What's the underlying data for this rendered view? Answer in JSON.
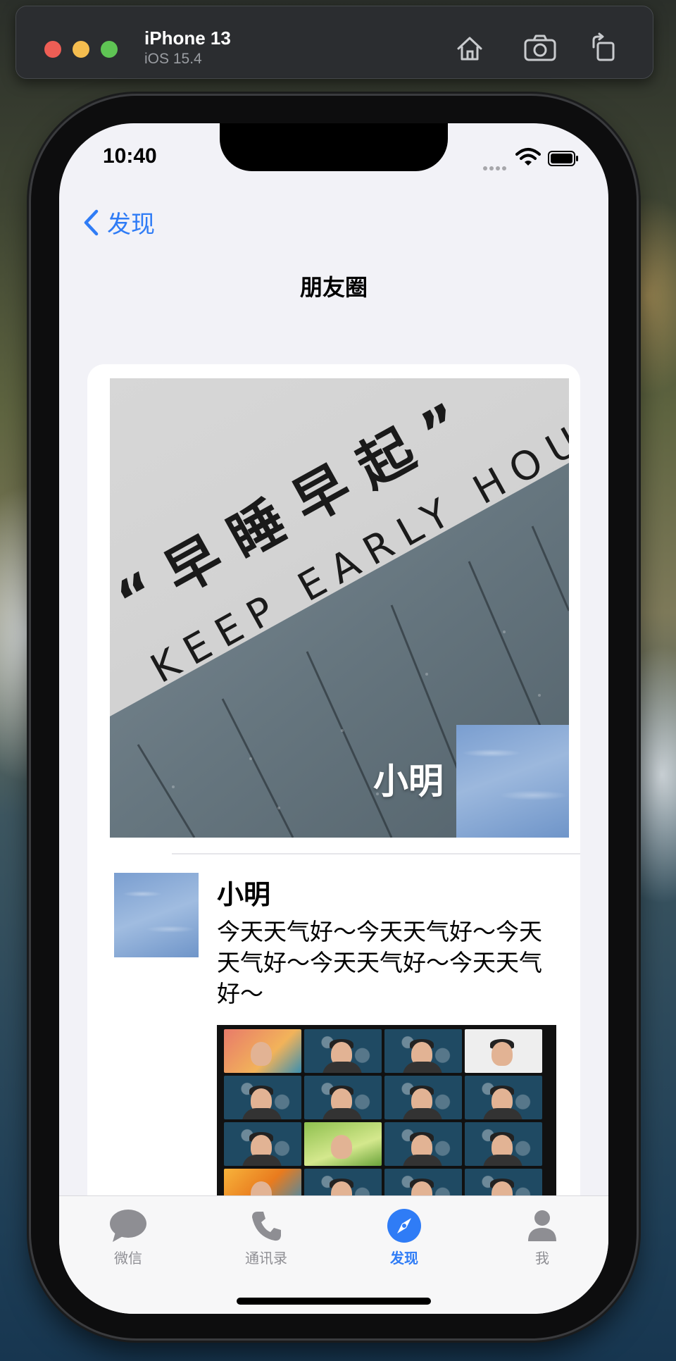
{
  "simulator": {
    "device_name": "iPhone 13",
    "os_version": "iOS 15.4",
    "toolbar_icons": [
      "home-icon",
      "screenshot-icon",
      "rotate-icon"
    ]
  },
  "status_bar": {
    "time": "10:40"
  },
  "nav": {
    "back_label": "发现",
    "title": "朋友圈"
  },
  "cover": {
    "name": "小明",
    "image_text_cn": "“早睡早起”",
    "image_text_en": "KEEP EARLY HOURS"
  },
  "post": {
    "author": "小明",
    "text": "今天天气好～今天天气好～今天天气好～今天天气好～今天天气好～"
  },
  "tabbar": {
    "items": [
      {
        "label": "微信",
        "icon": "chat-bubble-icon"
      },
      {
        "label": "通讯录",
        "icon": "phone-icon"
      },
      {
        "label": "发现",
        "icon": "compass-icon",
        "active": true
      },
      {
        "label": "我",
        "icon": "person-icon"
      }
    ]
  },
  "colors": {
    "accent": "#2f7cf6",
    "inactive": "#8e8e93"
  }
}
